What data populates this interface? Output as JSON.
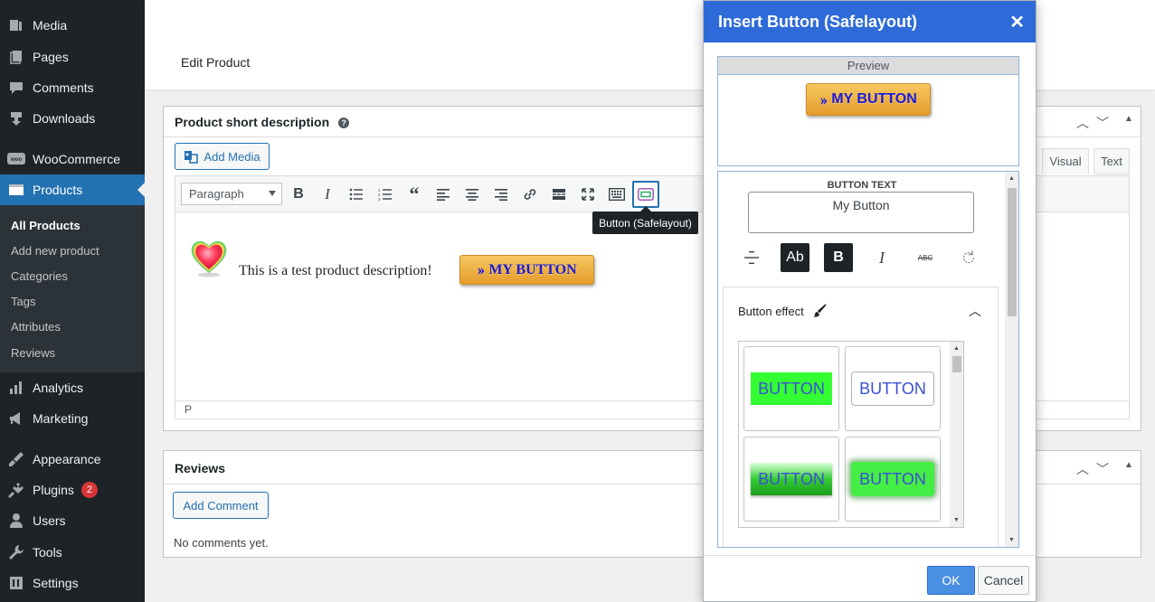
{
  "sidebar": {
    "items": [
      {
        "label": "Media",
        "icon": "media-icon"
      },
      {
        "label": "Pages",
        "icon": "pages-icon"
      },
      {
        "label": "Comments",
        "icon": "comments-icon"
      },
      {
        "label": "Downloads",
        "icon": "downloads-icon"
      },
      {
        "label": "WooCommerce",
        "icon": "woocommerce-icon"
      },
      {
        "label": "Products",
        "icon": "products-icon"
      },
      {
        "label": "Analytics",
        "icon": "analytics-icon"
      },
      {
        "label": "Marketing",
        "icon": "marketing-icon"
      },
      {
        "label": "Appearance",
        "icon": "appearance-icon"
      },
      {
        "label": "Plugins",
        "icon": "plugins-icon",
        "badge": "2"
      },
      {
        "label": "Users",
        "icon": "users-icon"
      },
      {
        "label": "Tools",
        "icon": "tools-icon"
      },
      {
        "label": "Settings",
        "icon": "settings-icon"
      }
    ],
    "submenu": [
      "All Products",
      "Add new product",
      "Categories",
      "Tags",
      "Attributes",
      "Reviews"
    ]
  },
  "header": {
    "title": "Edit Product"
  },
  "short_description": {
    "title": "Product short description",
    "help": "?",
    "add_media": "Add Media",
    "format_value": "Paragraph",
    "tooltip": "Button (Safelayout)",
    "body_text": "This is a test product description!",
    "inline_button": "MY BUTTON",
    "status_path": "P",
    "tab_visual": "Visual",
    "tab_text": "Text"
  },
  "reviews": {
    "title": "Reviews",
    "add_comment": "Add Comment",
    "empty": "No comments yet."
  },
  "modal": {
    "title": "Insert Button (Safelayout)",
    "close": "✕",
    "preview_label": "Preview",
    "preview_button": "MY BUTTON",
    "button_text_label": "BUTTON TEXT",
    "button_text_value": "My Button",
    "fmt_ab": "Ab",
    "fmt_bold": "B",
    "fmt_italic": "I",
    "fmt_strike": "ABC",
    "effect_title": "Button effect",
    "effects": [
      "BUTTON",
      "BUTTON",
      "BUTTON",
      "BUTTON"
    ],
    "ok": "OK",
    "cancel": "Cancel"
  },
  "colors": {
    "sidebar_bg": "#1d2327",
    "active": "#2271b1",
    "modal_header": "#2e6bd8",
    "button_gold": "#f0b44a",
    "button_text": "#1a1ad6",
    "effect_green": "#33ff33"
  }
}
